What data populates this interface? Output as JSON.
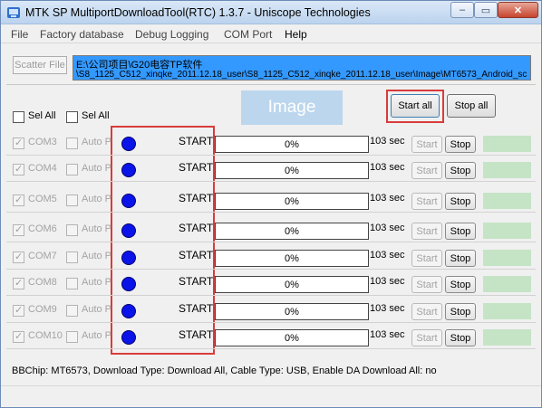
{
  "window": {
    "title": "MTK SP MultiportDownloadTool(RTC) 1.3.7 - Uniscope Technologies",
    "controls": {
      "minimize": "–",
      "maximize": "▭",
      "close": "✕"
    }
  },
  "menu": [
    "File",
    "Factory database",
    "Debug Logging",
    "COM Port",
    "Help"
  ],
  "scatter": {
    "button_label": "Scatter File",
    "path_line1": "E:\\公司项目\\G20电容TP软件",
    "path_line2": "\\S8_1125_C512_xinqke_2011.12.18_user\\S8_1125_C512_xinqke_2011.12.18_user\\Image\\MT6573_Android_sc"
  },
  "select_all": [
    {
      "label": "Sel All"
    },
    {
      "label": "Sel All"
    }
  ],
  "image_placeholder": "Image",
  "buttons": {
    "start_all": "Start all",
    "stop_all": "Stop all"
  },
  "ports": [
    {
      "name": "COM3",
      "auto": "Auto PL",
      "action": "START",
      "progress": "0%",
      "time": "103 sec",
      "start": "Start",
      "stop": "Stop"
    },
    {
      "name": "COM4",
      "auto": "Auto PL",
      "action": "START",
      "progress": "0%",
      "time": "103 sec",
      "start": "Start",
      "stop": "Stop"
    },
    {
      "name": "COM5",
      "auto": "Auto PL",
      "action": "START",
      "progress": "0%",
      "time": "103 sec",
      "start": "Start",
      "stop": "Stop"
    },
    {
      "name": "COM6",
      "auto": "Auto PL",
      "action": "START",
      "progress": "0%",
      "time": "103 sec",
      "start": "Start",
      "stop": "Stop"
    },
    {
      "name": "COM7",
      "auto": "Auto PL",
      "action": "START",
      "progress": "0%",
      "time": "103 sec",
      "start": "Start",
      "stop": "Stop"
    },
    {
      "name": "COM8",
      "auto": "Auto PL",
      "action": "START",
      "progress": "0%",
      "time": "103 sec",
      "start": "Start",
      "stop": "Stop"
    },
    {
      "name": "COM9",
      "auto": "Auto PL",
      "action": "START",
      "progress": "0%",
      "time": "103 sec",
      "start": "Start",
      "stop": "Stop"
    },
    {
      "name": "COM10",
      "auto": "Auto PL",
      "action": "START",
      "progress": "0%",
      "time": "103 sec",
      "start": "Start",
      "stop": "Stop"
    }
  ],
  "statusbar": "BBChip: MT6573,  Download Type: Download All,  Cable Type: USB,  Enable DA Download All: no",
  "colors": {
    "highlight_frame": "#d93b3b",
    "status_dot": "#0a14e8",
    "path_selection": "#3399ff",
    "port_status": "#c5e4c6"
  }
}
